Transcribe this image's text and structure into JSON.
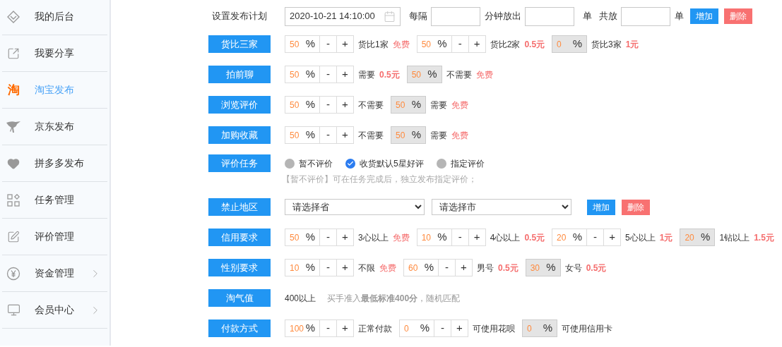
{
  "sidebar": {
    "items": [
      {
        "label": "我的后台",
        "selected": false,
        "expandable": false
      },
      {
        "label": "我要分享",
        "selected": false,
        "expandable": false
      },
      {
        "label": "淘宝发布",
        "selected": true,
        "expandable": false,
        "icon_text": "淘"
      },
      {
        "label": "京东发布",
        "selected": false,
        "expandable": false
      },
      {
        "label": "拼多多发布",
        "selected": false,
        "expandable": false
      },
      {
        "label": "任务管理",
        "selected": false,
        "expandable": false
      },
      {
        "label": "评价管理",
        "selected": false,
        "expandable": false
      },
      {
        "label": "资金管理",
        "selected": false,
        "expandable": true
      },
      {
        "label": "会员中心",
        "selected": false,
        "expandable": true
      }
    ]
  },
  "schedule": {
    "label": "设置发布计划",
    "datetime": "2020-10-21 14:10:00",
    "every": "每隔",
    "minutes": "分钟放出",
    "unit_1": "单",
    "total": "共放",
    "unit_2": "单",
    "add": "增加",
    "delete": "删除"
  },
  "rows": [
    {
      "kind": "percent",
      "label": "货比三家",
      "items": [
        {
          "value": "50",
          "unit": "%",
          "readonly": false,
          "stepper": [
            "-",
            "+"
          ],
          "text": "货比1家",
          "price": {
            "text": "免费",
            "kind": "free"
          }
        },
        {
          "value": "50",
          "unit": "%",
          "readonly": false,
          "stepper": [
            "-",
            "+"
          ],
          "text": "货比2家",
          "price": {
            "text": "0.5元",
            "kind": "paid"
          }
        },
        {
          "value": "0",
          "unit": "%",
          "readonly": true,
          "text": "货比3家",
          "price": {
            "text": "1元",
            "kind": "paid"
          }
        }
      ]
    },
    {
      "kind": "percent",
      "label": "拍前聊",
      "items": [
        {
          "value": "50",
          "unit": "%",
          "readonly": false,
          "stepper": [
            "-",
            "+"
          ],
          "text": "需要",
          "price": {
            "text": "0.5元",
            "kind": "paid"
          }
        },
        {
          "value": "50",
          "unit": "%",
          "readonly": true,
          "text": "不需要",
          "price": {
            "text": "免费",
            "kind": "free"
          }
        }
      ]
    },
    {
      "kind": "percent",
      "label": "浏览评价",
      "items": [
        {
          "value": "50",
          "unit": "%",
          "readonly": false,
          "stepper": [
            "-",
            "+"
          ],
          "text": "不需要"
        },
        {
          "value": "50",
          "unit": "%",
          "readonly": true,
          "text": "需要",
          "price": {
            "text": "免费",
            "kind": "free"
          }
        }
      ]
    },
    {
      "kind": "percent",
      "label": "加购收藏",
      "items": [
        {
          "value": "50",
          "unit": "%",
          "readonly": false,
          "stepper": [
            "-",
            "+"
          ],
          "text": "不需要"
        },
        {
          "value": "50",
          "unit": "%",
          "readonly": true,
          "text": "需要",
          "price": {
            "text": "免费",
            "kind": "free"
          }
        }
      ]
    },
    {
      "kind": "radio",
      "label": "评价任务",
      "options": [
        {
          "label": "暂不评价",
          "selected": false
        },
        {
          "label": "收货默认5星好评",
          "selected": true
        },
        {
          "label": "指定评价",
          "selected": false
        }
      ],
      "note": "【暂不评价】可在任务完成后，独立发布指定评价；"
    },
    {
      "kind": "region",
      "label": "禁止地区",
      "selects": [
        "请选择省",
        "请选择市"
      ],
      "add": "增加",
      "delete": "删除"
    },
    {
      "kind": "percent",
      "label": "信用要求",
      "items": [
        {
          "value": "50",
          "unit": "%",
          "readonly": false,
          "stepper": [
            "-",
            "+"
          ],
          "text": "3心以上",
          "price": {
            "text": "免费",
            "kind": "free"
          }
        },
        {
          "value": "10",
          "unit": "%",
          "readonly": false,
          "stepper": [
            "-",
            "+"
          ],
          "text": "4心以上",
          "price": {
            "text": "0.5元",
            "kind": "paid"
          }
        },
        {
          "value": "20",
          "unit": "%",
          "readonly": false,
          "stepper": [
            "-",
            "+"
          ],
          "text": "5心以上",
          "price": {
            "text": "1元",
            "kind": "paid"
          }
        },
        {
          "value": "20",
          "unit": "%",
          "readonly": true,
          "text": "1钻以上",
          "price": {
            "text": "1.5元",
            "kind": "paid"
          }
        }
      ]
    },
    {
      "kind": "percent",
      "label": "性别要求",
      "items": [
        {
          "value": "10",
          "unit": "%",
          "readonly": false,
          "stepper": [
            "-",
            "+"
          ],
          "text": "不限",
          "price": {
            "text": "免费",
            "kind": "free"
          }
        },
        {
          "value": "60",
          "unit": "%",
          "readonly": false,
          "stepper": [
            "-",
            "+"
          ],
          "text": "男号",
          "price": {
            "text": "0.5元",
            "kind": "paid"
          }
        },
        {
          "value": "30",
          "unit": "%",
          "readonly": true,
          "text": "女号",
          "price": {
            "text": "0.5元",
            "kind": "paid"
          }
        }
      ]
    },
    {
      "kind": "text",
      "label": "淘气值",
      "value": "400以上",
      "note": "买手准入**最低标准400分**，随机匹配"
    },
    {
      "kind": "percent",
      "label": "付款方式",
      "items": [
        {
          "value": "100",
          "unit": "%",
          "readonly": false,
          "stepper": [
            "-",
            "+"
          ],
          "text": "正常付款"
        },
        {
          "value": "0",
          "unit": "%",
          "readonly": false,
          "stepper": [
            "-",
            "+"
          ],
          "text": "可使用花呗"
        },
        {
          "value": "0",
          "unit": "%",
          "readonly": true,
          "text": "可使用信用卡"
        }
      ]
    }
  ]
}
